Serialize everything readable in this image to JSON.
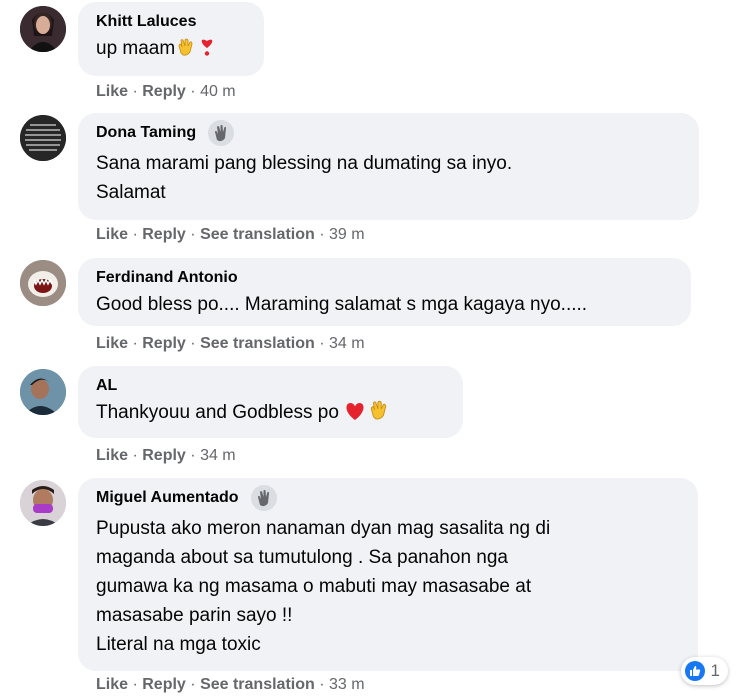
{
  "comments": [
    {
      "author": "Khitt Laluces",
      "lines": [
        "up maam"
      ],
      "actions": {
        "like": "Like",
        "reply": "Reply",
        "time": "40 m"
      }
    },
    {
      "author": "Dona Taming",
      "lines": [
        "Sana marami pang blessing na dumating sa inyo.",
        "Salamat"
      ],
      "actions": {
        "like": "Like",
        "reply": "Reply",
        "translate": "See translation",
        "time": "39 m"
      }
    },
    {
      "author": "Ferdinand Antonio",
      "lines": [
        "Good bless po.... Maraming salamat s mga kagaya nyo....."
      ],
      "actions": {
        "like": "Like",
        "reply": "Reply",
        "translate": "See translation",
        "time": "34 m"
      }
    },
    {
      "author": "AL",
      "lines": [
        "Thankyouu and Godbless po"
      ],
      "actions": {
        "like": "Like",
        "reply": "Reply",
        "time": "34 m"
      }
    },
    {
      "author": "Miguel Aumentado",
      "lines": [
        "Pupusta ako meron nanaman dyan mag sasalita ng di",
        "maganda about sa tumutulong . Sa panahon nga",
        "gumawa ka ng masama o mabuti may masasabe at",
        "masasabe parin sayo !!",
        "Literal na mga toxic"
      ],
      "actions": {
        "like": "Like",
        "reply": "Reply",
        "translate": "See translation",
        "time": "33 m"
      },
      "reaction_count": "1"
    }
  ],
  "separator": "·",
  "colors": {
    "bubble": "#f0f2f5",
    "meta": "#65676b",
    "like_blue": "#1877f2",
    "heart": "#e4232f",
    "clap": "#f6c12e"
  }
}
